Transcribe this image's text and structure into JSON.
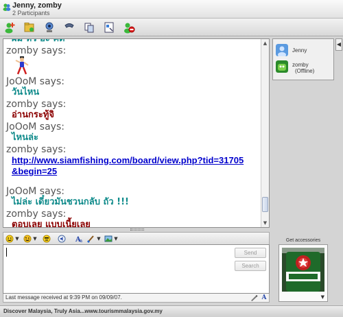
{
  "window": {
    "title": "Jenny, zomby",
    "subtitle": "2 Participants"
  },
  "conversation": [
    {
      "type": "msg",
      "style": "teal",
      "text": "ผม หิว อ่ะ คิด"
    },
    {
      "type": "says",
      "text": "zomby says:"
    },
    {
      "type": "emoticon"
    },
    {
      "type": "says",
      "text": "JoOoM says:"
    },
    {
      "type": "msg",
      "style": "teal",
      "text": "วันไหน"
    },
    {
      "type": "says",
      "text": "zomby says:"
    },
    {
      "type": "msg",
      "style": "maroon",
      "text": "อ่านกระทู้จิ"
    },
    {
      "type": "says",
      "text": "JoOoM says:"
    },
    {
      "type": "msg",
      "style": "teal",
      "text": "ไหนล่ะ"
    },
    {
      "type": "says",
      "text": "zomby says:"
    },
    {
      "type": "link",
      "lines": [
        "http://www.siamfishing.com/board/view.php?tid=31705",
        "&begin=25"
      ]
    },
    {
      "type": "spacer"
    },
    {
      "type": "says",
      "text": "JoOoM says:"
    },
    {
      "type": "msg",
      "style": "teal",
      "text": "ไม่ล่ะ เดี๋ยวมันชวนกลับ ถัว !!!"
    },
    {
      "type": "says",
      "text": "zomby says:"
    },
    {
      "type": "msg",
      "style": "maroon",
      "text": "ตอบเลย แบบเนี้ยเลย"
    }
  ],
  "buttons": {
    "send": "Send",
    "search": "Search"
  },
  "status": {
    "last_message": "Last message received at 9:39 PM on 09/09/07."
  },
  "participants": [
    {
      "name": "Jenny",
      "status": ""
    },
    {
      "name": "zomby",
      "status": "(Offline)"
    }
  ],
  "accessories": {
    "label": "Get accessories"
  },
  "ad": {
    "text": "Discover Malaysia, Truly Asia...www.tourismmalaysia.gov.my"
  },
  "colors": {
    "teal": "#108b8b",
    "maroon": "#8b0000",
    "link": "#0000cc"
  }
}
